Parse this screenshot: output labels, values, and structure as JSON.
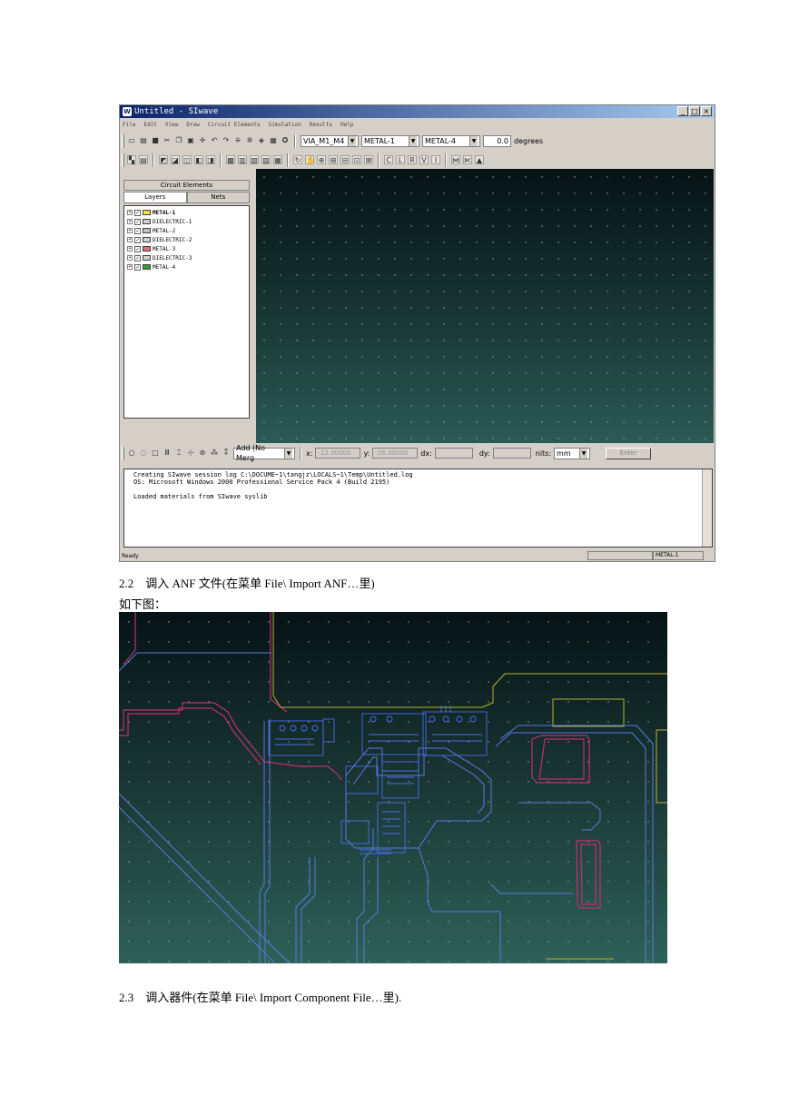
{
  "window": {
    "title": "Untitled - SIwave",
    "controls": [
      "_",
      "□",
      "×"
    ]
  },
  "menu": [
    "File",
    "Edit",
    "View",
    "Draw",
    "Circuit Elements",
    "Simulation",
    "Results",
    "Help"
  ],
  "toolbar": {
    "via_select": "VIA_M1_M4",
    "start_layer": "METAL-1",
    "end_layer": "METAL-4",
    "angle_value": "0.0",
    "angle_unit": "degrees"
  },
  "left_panel": {
    "header": "Circuit Elements",
    "tabs": [
      "Layers",
      "Nets"
    ],
    "layers": [
      {
        "name": "METAL-1",
        "color": "#f0e040"
      },
      {
        "name": "DIELECTRIC-1",
        "color": "#d0d0d0"
      },
      {
        "name": "METAL-2",
        "color": "#c0c0c0"
      },
      {
        "name": "DIELECTRIC-2",
        "color": "#d0d0d0"
      },
      {
        "name": "METAL-3",
        "color": "#e07070"
      },
      {
        "name": "DIELECTRIC-3",
        "color": "#d0d0d0"
      },
      {
        "name": "METAL-4",
        "color": "#30a030"
      }
    ]
  },
  "coord_bar": {
    "mode": "Add (No Merg",
    "x_label": "x:",
    "x_value": "-12.00000",
    "y_label": "y:",
    "y_value": "-26.00000",
    "dx_label": "dx:",
    "dy_label": "dy:",
    "units_label": "nits:",
    "units_value": "mm",
    "enter_label": "Enter"
  },
  "log": [
    "Creating SIwave session log C:\\DOCUME~1\\tangjz\\LOCALS~1\\Temp\\Untitled.log",
    "OS: Microsoft Windows 2000 Professional Service Pack 4 (Build 2195)",
    "",
    "Loaded materials from SIwave syslib"
  ],
  "status": {
    "left": "Ready",
    "layer": "METAL-1"
  },
  "document": {
    "caption_22": "2.2　调入 ANF 文件(在菜单 File\\ Import ANF…里)",
    "caption_22_sub": "如下图：",
    "caption_23": "2.3　调入器件(在菜单 File\\ Import Component File…里)."
  },
  "colors": {
    "canvas_top": "#061315",
    "canvas_bottom": "#2c5a55",
    "trace_blue": "#5a78e0",
    "trace_magenta": "#c0306a",
    "trace_yellow": "#b8b030"
  }
}
